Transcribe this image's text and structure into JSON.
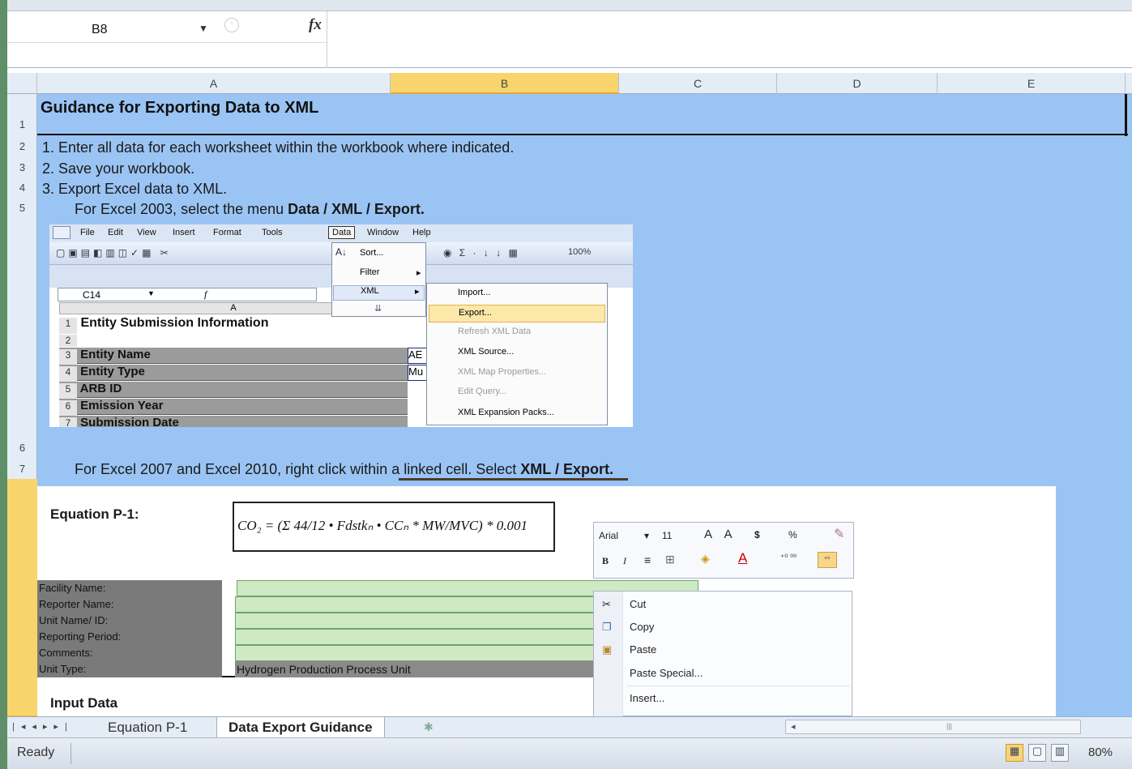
{
  "name_box": "B8",
  "formula_icon": "fx",
  "columns": [
    "A",
    "B",
    "C",
    "D",
    "E"
  ],
  "rows": [
    "1",
    "2",
    "3",
    "4",
    "5",
    "6",
    "7"
  ],
  "sheet": {
    "title": "Guidance for Exporting Data to XML",
    "step1": "1.  Enter all data for each worksheet within the workbook where indicated.",
    "step2": "2.  Save your workbook.",
    "step3": "3.  Export Excel data to XML.",
    "excel2003_prefix": "For Excel 2003,  select the menu ",
    "excel2003_bold": "Data / XML / Export.",
    "excel2007_prefix": "For Excel 2007 and Excel 2010,  right click within a linked cell. Select ",
    "excel2007_bold": "XML / Export."
  },
  "img2003": {
    "menus": [
      "File",
      "Edit",
      "View",
      "Insert",
      "Format",
      "Tools",
      "Data",
      "Window",
      "Help"
    ],
    "zoom": "100%",
    "name_box": "C14",
    "col_a": "A",
    "data_menu": [
      "Sort...",
      "Filter",
      "XML"
    ],
    "xml_menu": [
      "Import...",
      "Export...",
      "Refresh XML Data",
      "XML Source...",
      "XML Map Properties...",
      "Edit Query...",
      "XML Expansion Packs..."
    ],
    "rows": [
      {
        "n": "1",
        "label": "Entity Submission Information"
      },
      {
        "n": "2",
        "label": ""
      },
      {
        "n": "3",
        "label": "Entity Name"
      },
      {
        "n": "4",
        "label": "Entity Type"
      },
      {
        "n": "5",
        "label": "ARB ID"
      },
      {
        "n": "6",
        "label": "Emission Year"
      },
      {
        "n": "7",
        "label": "Submission Date"
      }
    ],
    "cell_peek": [
      "AE",
      "Mu"
    ]
  },
  "equation": {
    "label": "Equation P-1:",
    "formula": "CO₂ = (Σ 44/12 • Fdstkₙ • CCₙ * MW/MVC) * 0.001",
    "fields": [
      "Facility Name:",
      "Reporter Name:",
      "Unit Name/ ID:",
      "Reporting Period:",
      "Comments:",
      "Unit Type:"
    ],
    "unit_type_value": "Hydrogen Production Process Unit",
    "input_data": "Input Data"
  },
  "mini_toolbar": {
    "font": "Arial",
    "size": "11",
    "currency": "$",
    "percent": "%",
    "bold": "B",
    "italic": "I"
  },
  "context_menu": [
    "Cut",
    "Copy",
    "Paste",
    "Paste Special...",
    "Insert..."
  ],
  "tabs": [
    "Equation P-1",
    "Data Export Guidance"
  ],
  "status": {
    "ready": "Ready",
    "zoom": "80%"
  },
  "colors": {
    "sheet_bg": "#9ac4f4",
    "selected_header": "#f8d56c",
    "field_green": "#cfe9c4"
  }
}
